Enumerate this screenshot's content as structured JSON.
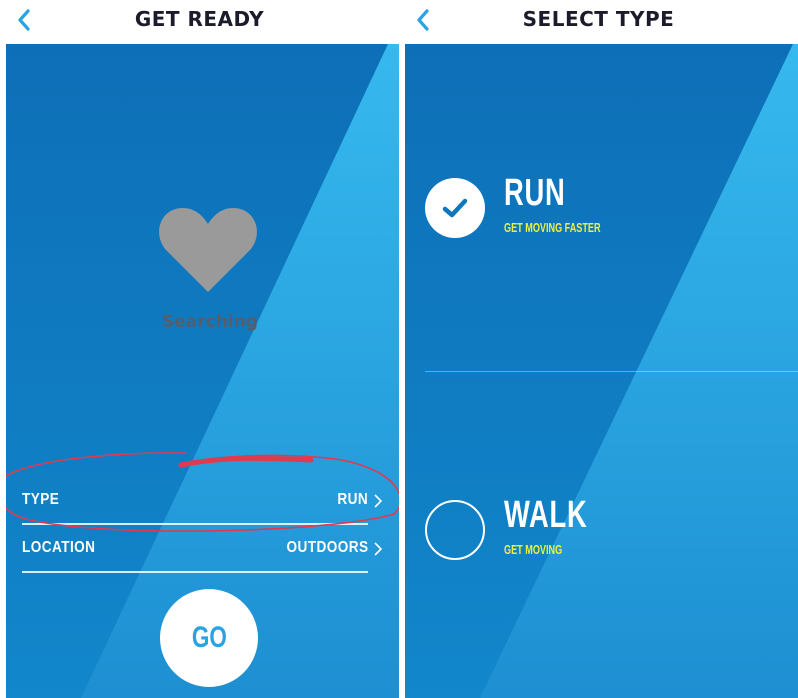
{
  "colors": {
    "panel_blue": "#0f78bd",
    "light_blue": "#35b4ea",
    "accent_yellow": "#ecf23a",
    "back_arrow": "#2aa3e3",
    "heart_gray": "#9a9a9a",
    "annotation_red": "#e03a4e"
  },
  "left_screen": {
    "title": "GET READY",
    "back_icon": "chevron-left-icon",
    "heart_icon": "heart-icon",
    "status": "Searching",
    "settings": [
      {
        "label": "TYPE",
        "value": "RUN"
      },
      {
        "label": "LOCATION",
        "value": "OUTDOORS"
      }
    ],
    "go_label": "GO"
  },
  "right_screen": {
    "title": "SELECT TYPE",
    "back_icon": "chevron-left-icon",
    "options": [
      {
        "title": "RUN",
        "subtitle": "GET MOVING FASTER",
        "selected": true
      },
      {
        "title": "WALK",
        "subtitle": "GET MOVING",
        "selected": false
      }
    ]
  }
}
